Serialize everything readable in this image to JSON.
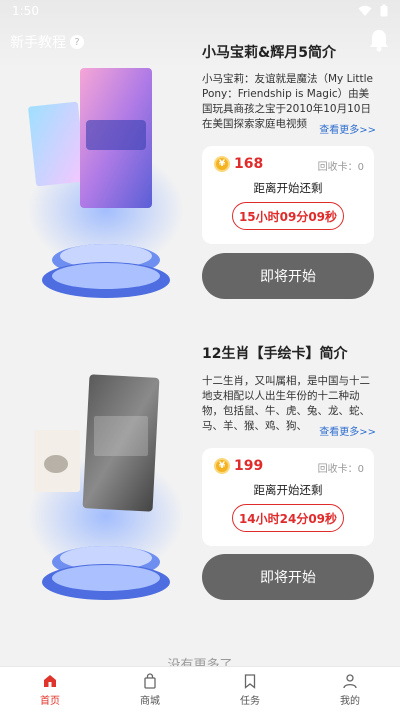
{
  "status_bar": {
    "time": "1:50"
  },
  "header": {
    "tutorial_label": "新手教程",
    "help_icon": "?"
  },
  "products": [
    {
      "title": "小马宝莉&辉月5简介",
      "description": "小马宝莉：友谊就是魔法（My Little Pony：Friendship is Magic）由美国玩具商孩之宝于2010年10月10日在美国探索家庭电视频",
      "more_label": "查看更多>>",
      "price": "168",
      "recycle_label": "回收卡：0",
      "countdown_label": "距离开始还剩",
      "countdown": "15小时09分09秒",
      "button_label": "即将开始"
    },
    {
      "title": "12生肖【手绘卡】简介",
      "description": "十二生肖，又叫属相，是中国与十二地支相配以人出生年份的十二种动物，包括鼠、牛、虎、兔、龙、蛇、马、羊、猴、鸡、狗、",
      "more_label": "查看更多>>",
      "price": "199",
      "recycle_label": "回收卡：0",
      "countdown_label": "距离开始还剩",
      "countdown": "14小时24分09秒",
      "button_label": "即将开始"
    }
  ],
  "no_more": "没有更多了",
  "tabbar": [
    {
      "label": "首页"
    },
    {
      "label": "商城"
    },
    {
      "label": "任务"
    },
    {
      "label": "我的"
    }
  ],
  "colors": {
    "accent": "#e02b2b",
    "button_gray": "#666666",
    "link_blue": "#2f6fd0"
  }
}
